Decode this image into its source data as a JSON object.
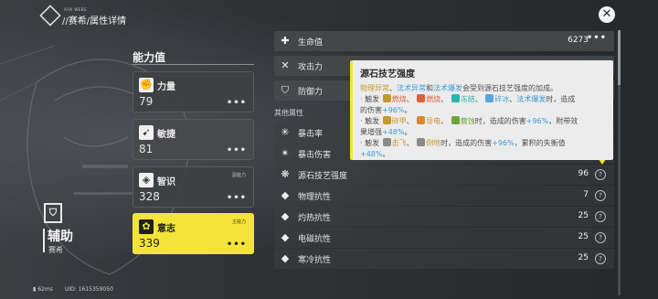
{
  "header": {
    "small_text": "ARK WEBE",
    "breadcrumb": "//赛希/属性详情"
  },
  "left_panel": {
    "title": "能力值",
    "stats": [
      {
        "name": "力量",
        "value": "79",
        "tag": "",
        "icon": "fist-icon"
      },
      {
        "name": "敏捷",
        "value": "81",
        "tag": "",
        "icon": "agility-icon"
      },
      {
        "name": "智识",
        "value": "328",
        "tag": "副能力",
        "icon": "intellect-icon"
      },
      {
        "name": "意志",
        "value": "339",
        "tag": "主能力",
        "icon": "will-icon"
      }
    ],
    "more_label": "•••",
    "role": "辅助",
    "character": "赛希",
    "ping": "62ms",
    "uid": "UID: 1615359050"
  },
  "right_panel": {
    "top_rows": [
      {
        "name": "生命值",
        "value": "6273",
        "icon": "health-icon"
      },
      {
        "name": "攻击力",
        "value": "",
        "icon": "attack-icon"
      },
      {
        "name": "防御力",
        "value": "",
        "icon": "defense-icon"
      }
    ],
    "other_label": "其他属性",
    "other_rows": [
      {
        "name": "暴击率",
        "value": "",
        "icon": "crit-rate-icon"
      },
      {
        "name": "暴击伤害",
        "value": "",
        "icon": "crit-dmg-icon"
      },
      {
        "name": "源石技艺强度",
        "value": "96",
        "icon": "arts-intensity-icon"
      },
      {
        "name": "物理抗性",
        "value": "7",
        "icon": "physical-res-icon"
      },
      {
        "name": "灼热抗性",
        "value": "25",
        "icon": "heat-res-icon"
      },
      {
        "name": "电磁抗性",
        "value": "25",
        "icon": "electric-res-icon"
      },
      {
        "name": "寒冷抗性",
        "value": "25",
        "icon": "cold-res-icon"
      }
    ],
    "help_symbol": "?",
    "more_label": "•••"
  },
  "tooltip": {
    "title": "源石技艺强度",
    "p1_a": "物理异常",
    "p1_sep": "、",
    "p1_b": "法术异常",
    "p1_and": "和",
    "p1_c": "法术爆发",
    "p1_rest": "会受到源石技艺强度的加成。",
    "l1_pre": "· 触发",
    "l1_a": "燃烧",
    "l1_b": "燃烧",
    "l1_c": "冻结",
    "l1_d": "碎冰",
    "l1_e": "法术爆发",
    "l1_post": "时，造成",
    "l1_tail": "的伤害",
    "l1_pct": "+96%",
    "l1_end": "。",
    "l2_pre": "· 触发",
    "l2_a": "碎甲",
    "l2_b": "导电",
    "l2_c": "腐蚀",
    "l2_post": "时，造成的伤害",
    "l2_pct": "+96%",
    "l2_mid": "，附带效",
    "l2_tail": "果增强",
    "l2_pct2": "+48%",
    "l2_end": "。",
    "l3_pre": "· 触发",
    "l3_a": "击飞",
    "l3_b": "倒地",
    "l3_post": "时，造成的伤害",
    "l3_pct": "+96%",
    "l3_mid": "，累积的失衡值",
    "l3_pct2": "+48%",
    "l3_end": "。"
  },
  "colors": {
    "accent_yellow": "#f4e43a",
    "panel_bg": "#2a2c2f"
  }
}
